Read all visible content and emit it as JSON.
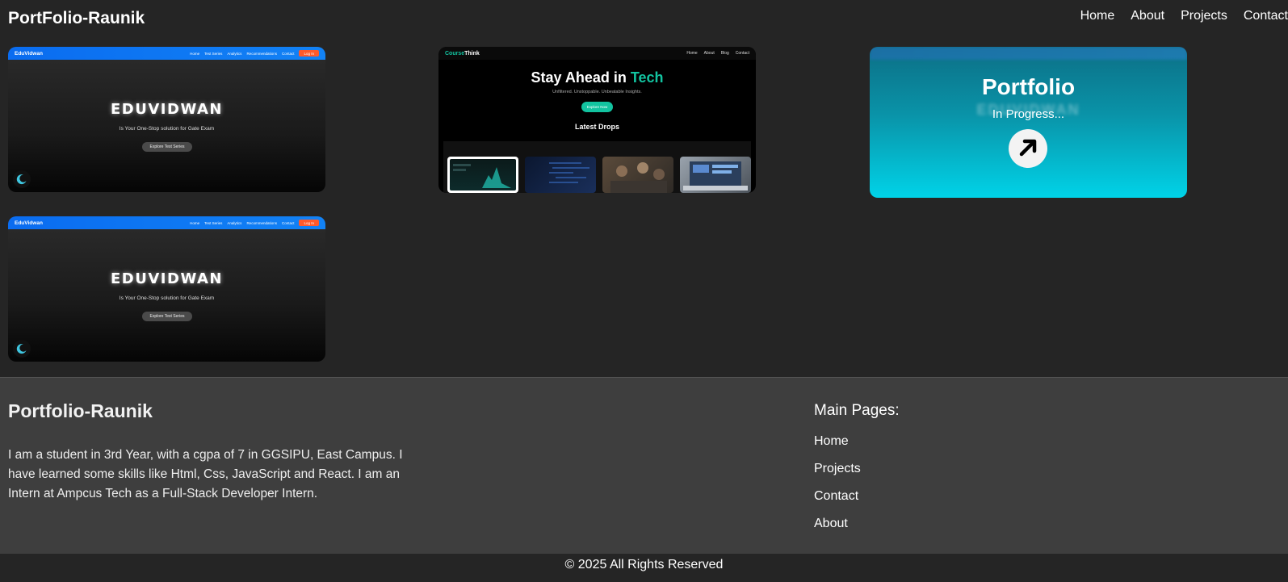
{
  "nav": {
    "brand": "PortFolio-Raunik",
    "links": [
      "Home",
      "About",
      "Projects",
      "Contact"
    ]
  },
  "cards": {
    "edu": {
      "logo": "EduVidwan",
      "menu": [
        "Home",
        "Test Series",
        "Analytics",
        "Recommendations",
        "Contact"
      ],
      "login": "Log In",
      "title": "EDUVIDWAN",
      "subtitle": "Is Your One-Stop solution for Gate Exam",
      "button": "Explore Test Series"
    },
    "course": {
      "logo_part1": "Course",
      "logo_part2": "Think",
      "menu": [
        "Home",
        "About",
        "Blog",
        "Contact"
      ],
      "headline": "Stay Ahead in ",
      "headline_accent": "Tech",
      "tagline": "Unfiltered. Unstoppable. Unbeatable Insights.",
      "cta": "Explore Now",
      "section": "Latest Drops"
    },
    "portfolio": {
      "ghost_title": "EDUVIDWAN",
      "title": "Portfolio",
      "subtitle": "In Progress..."
    }
  },
  "footer": {
    "brand": "Portfolio-Raunik",
    "about": "I am a student in 3rd Year, with a cgpa of 7 in GGSIPU, East Campus. I have learned some skills like Html, Css, JavaScript and React. I am an Intern at Ampcus Tech as a Full-Stack Developer Intern.",
    "heading": "Main Pages:",
    "links": [
      "Home",
      "Projects",
      "Contact",
      "About"
    ],
    "copyright": "© 2025 All Rights Reserved"
  },
  "colors": {
    "accent": "#12c3a0",
    "edu_blue": "#0a6cf0",
    "login_orange": "#ff5a2a",
    "portfolio_cyan": "#00d3e8"
  }
}
